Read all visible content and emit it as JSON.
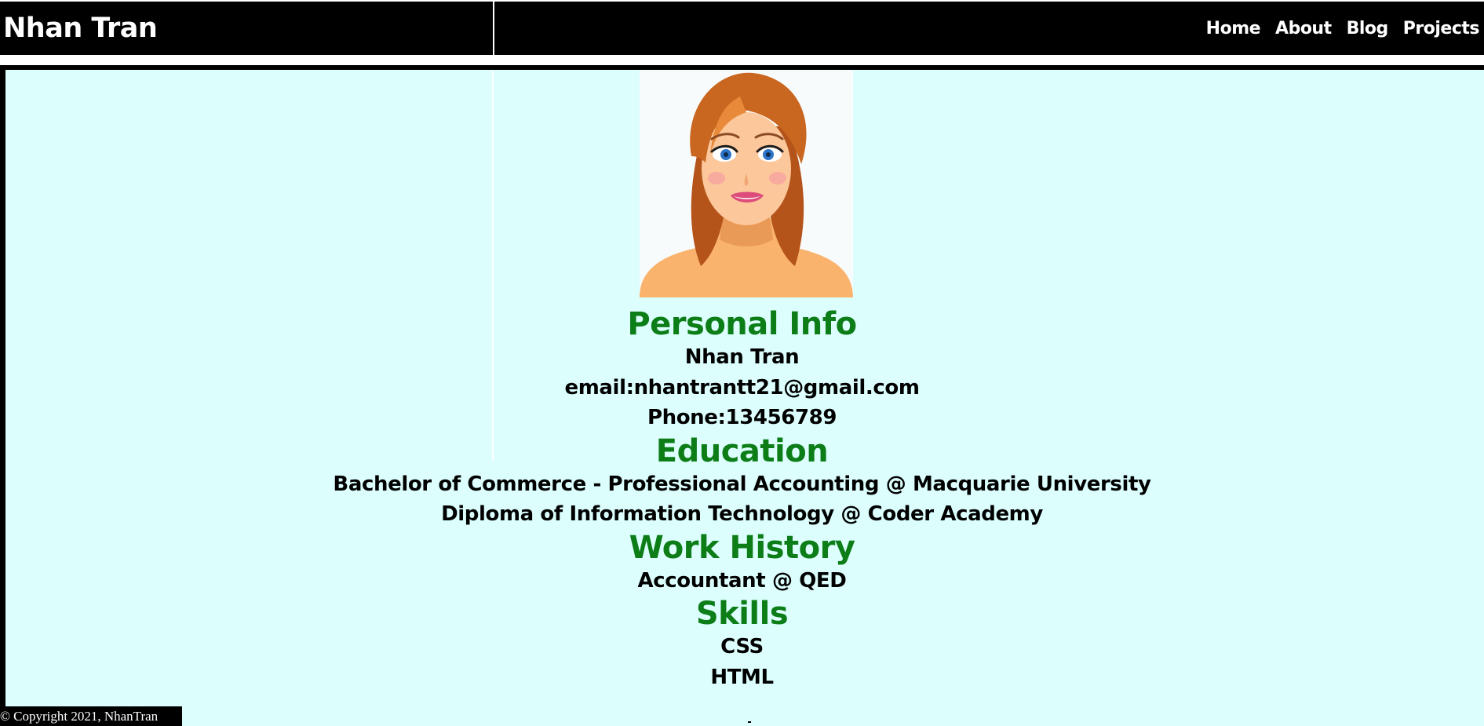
{
  "header": {
    "brand": "Nhan Tran",
    "nav": [
      "Home",
      "About",
      "Blog",
      "Projects"
    ]
  },
  "colors": {
    "header_bg": "#000000",
    "page_bg": "#dcfffe",
    "heading": "#0c7d17",
    "text": "#000000"
  },
  "profile": {
    "avatar_icon": "cartoon-woman-portrait"
  },
  "personal_info": {
    "title": "Personal Info",
    "name": "Nhan Tran",
    "email": "email:nhantrantt21@gmail.com",
    "phone": "Phone:13456789"
  },
  "education": {
    "title": "Education",
    "items": [
      "Bachelor of Commerce - Professional Accounting @ Macquarie University",
      "Diploma of Information Technology @ Coder Academy"
    ]
  },
  "work_history": {
    "title": "Work History",
    "items": [
      "Accountant @ QED"
    ]
  },
  "skills": {
    "title": "Skills",
    "items": [
      "CSS",
      "HTML"
    ]
  },
  "footer": {
    "text": "© Copyright 2021, NhanTran"
  }
}
